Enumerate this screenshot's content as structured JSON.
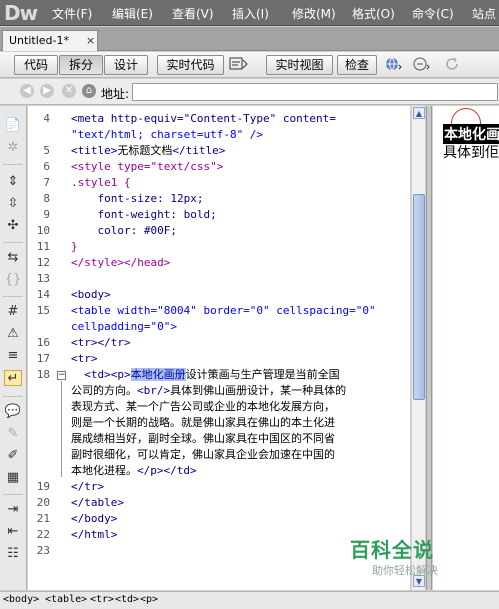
{
  "app": {
    "logo": "Dw"
  },
  "menu": [
    "文件(F)",
    "编辑(E)",
    "查看(V)",
    "插入(I)",
    "修改(M)",
    "格式(O)",
    "命令(C)",
    "站点"
  ],
  "document_tab": {
    "title": "Untitled-1*",
    "close": "×"
  },
  "toolbar": {
    "code": "代码",
    "split": "拆分",
    "design": "设计",
    "live_code": "实时代码",
    "live_view": "实时视图",
    "inspect": "检查"
  },
  "address": {
    "label": "地址:",
    "value": ""
  },
  "code_lines": [
    {
      "num": "4"
    },
    {
      "num": ""
    },
    {
      "num": "5"
    },
    {
      "num": "6"
    },
    {
      "num": "7"
    },
    {
      "num": "8"
    },
    {
      "num": "9"
    },
    {
      "num": "10"
    },
    {
      "num": "11"
    },
    {
      "num": "12"
    },
    {
      "num": "13"
    },
    {
      "num": "14"
    },
    {
      "num": "15"
    },
    {
      "num": ""
    },
    {
      "num": "16"
    },
    {
      "num": "17"
    },
    {
      "num": "18"
    },
    {
      "num": "19"
    },
    {
      "num": "20"
    },
    {
      "num": "21"
    },
    {
      "num": "22"
    },
    {
      "num": "23"
    }
  ],
  "code": {
    "l4a": "<meta http-equiv=\"Content-Type\" content=",
    "l4b": "\"text/html; charset=utf-8\" />",
    "l5_open": "<title>",
    "l5_text": "无标题文档",
    "l5_close": "</title>",
    "l6": "<style type=\"text/css\">",
    "l7": ".style1 {",
    "l8": "    font-size: 12px;",
    "l9": "    font-weight: bold;",
    "l10": "    color: #00F;",
    "l11": "}",
    "l12": "</style></head>",
    "l14": "<body>",
    "l15a": "<table width=\"8004\" border=\"0\" cellspacing=\"0\"",
    "l15b": "cellpadding=\"0\">",
    "l16": "<tr></tr>",
    "l17": "<tr>",
    "l18_tags": "  <td><p>",
    "l18_hl": "本地化画册",
    "l18_rest": "设计策画与生产管理是当前全国",
    "l18_w2a": "公司的方向。",
    "l18_br": "<br/>",
    "l18_w2b": "具体到佛山画册设计，某一种具体的",
    "l18_w3": "表现方式、某一个广告公司或企业的本地化发展方向，",
    "l18_w4": "则是一个长期的战略。就是佛山家具在佛山的本土化进",
    "l18_w5": "展成绩相当好，副时全球。佛山家具在中国区的不同省",
    "l18_w6": "副时很细化，可以肯定，佛山家具企业会加速在中国的",
    "l18_w7a": "本地化进程。",
    "l18_w7b": "</p></td>",
    "l19": "</tr>",
    "l20": "</table>",
    "l21": "</body>",
    "l22": "</html>"
  },
  "design_view": {
    "line1": "本地化画",
    "line2": "具体到佢"
  },
  "status_bar": {
    "tags": [
      "<body>",
      "<table>",
      "<tr>",
      "<td>",
      "<p>"
    ]
  },
  "watermark": {
    "title": "百科全说",
    "subtitle": "助你轻松解决"
  }
}
